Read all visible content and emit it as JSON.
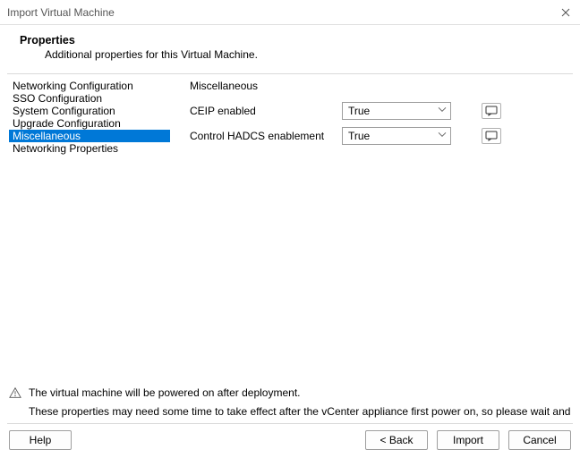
{
  "title": "Import Virtual Machine",
  "header": {
    "title": "Properties",
    "subtitle": "Additional properties for this Virtual Machine."
  },
  "sidebar": {
    "items": [
      {
        "label": "Networking Configuration"
      },
      {
        "label": "SSO Configuration"
      },
      {
        "label": "System Configuration"
      },
      {
        "label": "Upgrade Configuration"
      },
      {
        "label": "Miscellaneous"
      },
      {
        "label": "Networking Properties"
      }
    ],
    "selected_index": 4
  },
  "panel": {
    "title": "Miscellaneous",
    "rows": [
      {
        "label": "CEIP enabled",
        "value": "True"
      },
      {
        "label": "Control HADCS enablement",
        "value": "True"
      }
    ]
  },
  "footer": {
    "warn1": "The virtual machine will be powered on after deployment.",
    "warn2": "These properties may need some time to take effect after the vCenter appliance first power on, so please wait and do not shutd"
  },
  "buttons": {
    "help": "Help",
    "back": "< Back",
    "import": "Import",
    "cancel": "Cancel"
  }
}
